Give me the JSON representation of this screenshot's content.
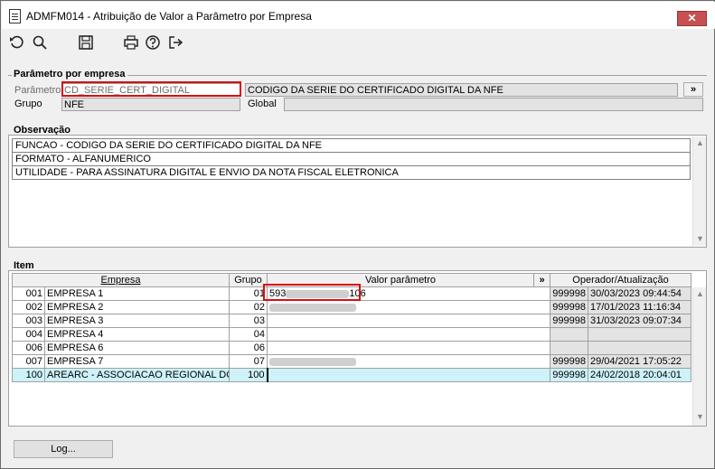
{
  "window": {
    "title": "ADMFM014 - Atribuição de Valor a Parâmetro por Empresa",
    "close_glyph": "✕"
  },
  "toolbar": {
    "icons": [
      "undo-icon",
      "search-icon",
      "save-icon",
      "print-icon",
      "help-icon",
      "exit-icon"
    ]
  },
  "parametro_section": {
    "title": "Parâmetro por empresa",
    "parametro_label": "Parâmetro",
    "parametro_value": "CD_SERIE_CERT_DIGITAL",
    "descricao_value": "CODIGO DA SERIE DO CERTIFICADO DIGITAL DA NFE",
    "expand_label": "»",
    "grupo_label": "Grupo",
    "grupo_value": "NFE",
    "global_label": "Global",
    "global_value": ""
  },
  "observacao_section": {
    "title": "Observação",
    "lines": [
      "FUNCAO - CODIGO DA SERIE DO CERTIFICADO DIGITAL DA NFE",
      "FORMATO - ALFANUMERICO",
      "UTILIDADE - PARA ASSINATURA DIGITAL E ENVIO DA NOTA FISCAL ELETRONICA"
    ]
  },
  "item_section": {
    "title": "Item",
    "columns": {
      "empresa": "Empresa",
      "grupo": "Grupo",
      "valor": "Valor parâmetro",
      "expand": "»",
      "operador": "Operador/Atualização"
    },
    "rows": [
      {
        "code": "001",
        "name": "EMPRESA 1",
        "grupo": "01",
        "valor_prefix": "593",
        "valor_suffix": "106",
        "operador": "999998",
        "data": "30/03/2023 09:44:54"
      },
      {
        "code": "002",
        "name": "EMPRESA 2",
        "grupo": "02",
        "valor_prefix": "",
        "valor_suffix": "",
        "operador": "999998",
        "data": "17/01/2023 11:16:34"
      },
      {
        "code": "003",
        "name": "EMPRESA 3",
        "grupo": "03",
        "valor_prefix": "",
        "valor_suffix": "",
        "operador": "999998",
        "data": "31/03/2023 09:07:34"
      },
      {
        "code": "004",
        "name": "EMPRESA 4",
        "grupo": "04",
        "valor_prefix": "",
        "valor_suffix": "",
        "operador": "",
        "data": ""
      },
      {
        "code": "006",
        "name": "EMPRESA 6",
        "grupo": "06",
        "valor_prefix": "",
        "valor_suffix": "",
        "operador": "",
        "data": ""
      },
      {
        "code": "007",
        "name": "EMPRESA 7",
        "grupo": "07",
        "valor_prefix": "",
        "valor_suffix": "",
        "operador": "999998",
        "data": "29/04/2021 17:05:22"
      },
      {
        "code": "100",
        "name": "AREARC - ASSOCIACAO REGIONAL DOS",
        "grupo": "100",
        "valor_prefix": "",
        "valor_suffix": "",
        "operador": "999998",
        "data": "24/02/2018 20:04:01"
      }
    ]
  },
  "footer": {
    "log_button": "Log..."
  }
}
